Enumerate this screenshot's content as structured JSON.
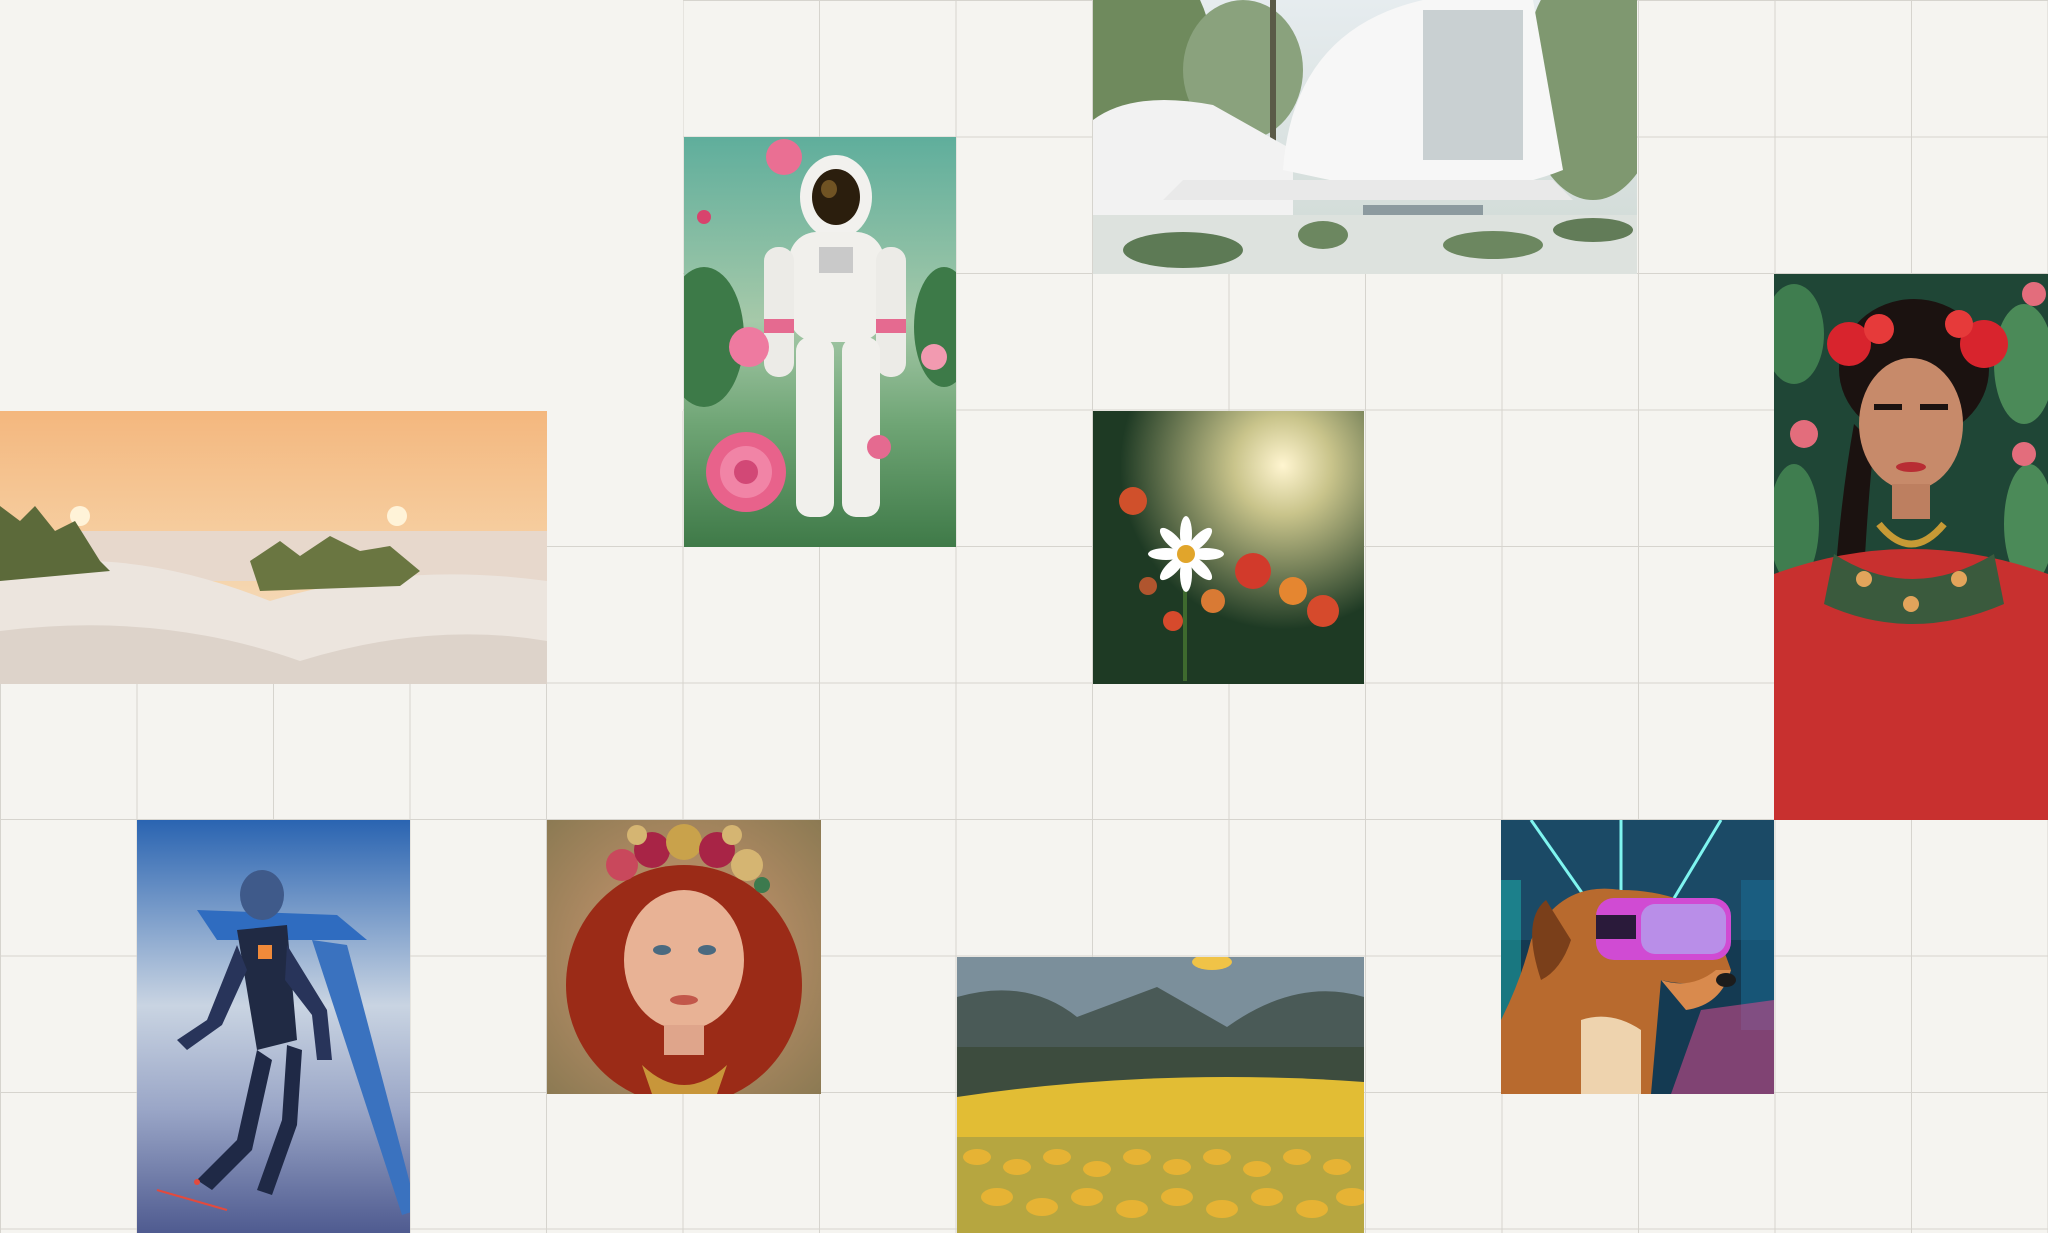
{
  "gallery": {
    "tiles": [
      {
        "subject": "astronaut-with-roses"
      },
      {
        "subject": "modern-white-house-in-forest"
      },
      {
        "subject": "woman-portrait-with-floral-headpiece"
      },
      {
        "subject": "sand-dunes-at-sunset"
      },
      {
        "subject": "daisy-in-sunlit-meadow"
      },
      {
        "subject": "blue-armored-robot-flying"
      },
      {
        "subject": "red-haired-woman-with-flower-crown"
      },
      {
        "subject": "yellow-flower-field-in-valley"
      },
      {
        "subject": "dog-wearing-vr-headset"
      }
    ]
  },
  "colors": {
    "background": "#f5f4f0",
    "grid_line": "#d6d4ce"
  }
}
